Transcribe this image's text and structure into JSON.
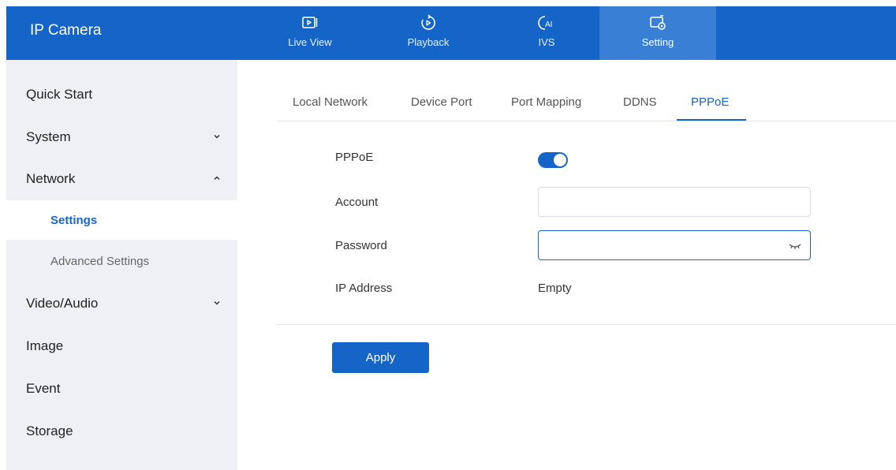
{
  "app": {
    "title": "IP Camera"
  },
  "topnav": [
    {
      "label": "Live View",
      "icon": "live-view-icon"
    },
    {
      "label": "Playback",
      "icon": "playback-icon"
    },
    {
      "label": "IVS",
      "icon": "ivs-ai-icon"
    },
    {
      "label": "Setting",
      "icon": "setting-icon",
      "active": true
    }
  ],
  "sidebar": {
    "items": [
      {
        "label": "Quick Start"
      },
      {
        "label": "System",
        "chevron": "down"
      },
      {
        "label": "Network",
        "chevron": "up",
        "expanded": true
      },
      {
        "label": "Settings",
        "sub": true,
        "active": true
      },
      {
        "label": "Advanced Settings",
        "sub": true
      },
      {
        "label": "Video/Audio",
        "chevron": "down"
      },
      {
        "label": "Image"
      },
      {
        "label": "Event"
      },
      {
        "label": "Storage"
      }
    ]
  },
  "tabs": [
    {
      "label": "Local Network"
    },
    {
      "label": "Device Port"
    },
    {
      "label": "Port Mapping"
    },
    {
      "label": "DDNS"
    },
    {
      "label": "PPPoE",
      "active": true
    }
  ],
  "form": {
    "pppoe_label": "PPPoE",
    "pppoe_enabled": true,
    "account_label": "Account",
    "account_value": "",
    "password_label": "Password",
    "password_value": "",
    "ip_label": "IP Address",
    "ip_value": "Empty"
  },
  "actions": {
    "apply_label": "Apply"
  },
  "colors": {
    "primary": "#1565c8",
    "sidebar_bg": "#eef0f5",
    "active_nav_bg": "#3a7fd6"
  }
}
